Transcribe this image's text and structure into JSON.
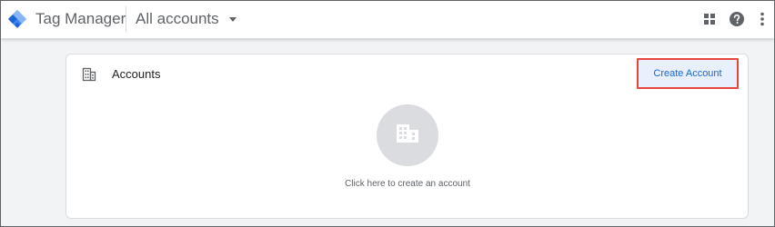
{
  "header": {
    "product_name": "Tag Manager",
    "account_picker": "All accounts",
    "icons": {
      "logo": "tag-manager-logo-icon",
      "apps": "apps-grid-icon",
      "help": "help-icon",
      "more": "more-vert-icon"
    }
  },
  "card": {
    "title": "Accounts",
    "title_icon": "building-icon",
    "create_button_label": "Create Account",
    "empty_icon": "building-icon",
    "empty_text": "Click here to create an account"
  },
  "colors": {
    "brand_blue": "#4285f4",
    "brand_dark_blue": "#1967d2",
    "highlight_red": "#e8453c"
  }
}
